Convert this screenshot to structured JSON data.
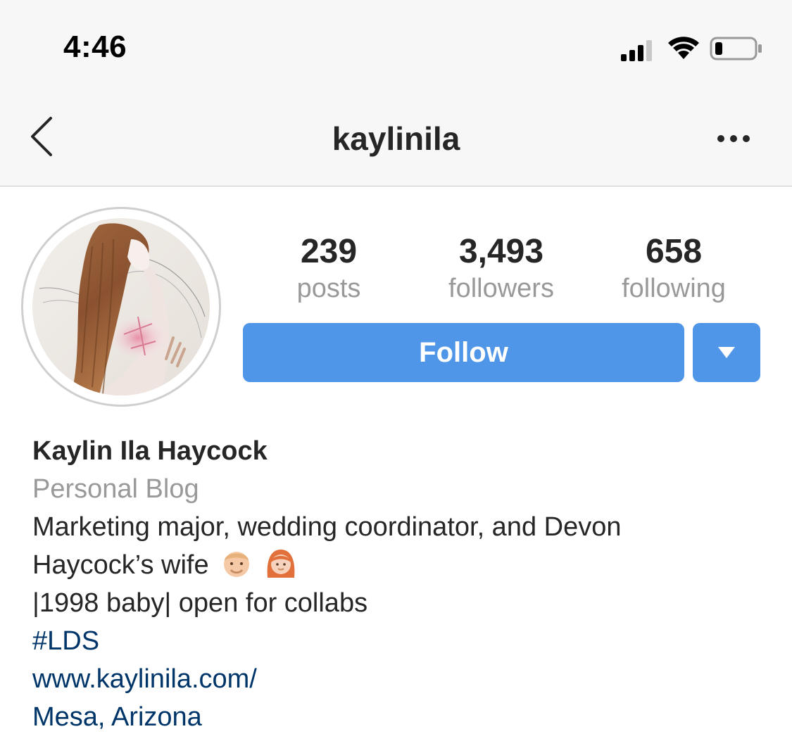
{
  "status_bar": {
    "time": "4:46",
    "signal_icon": "cellular-signal-icon",
    "wifi_icon": "wifi-icon",
    "battery_icon": "battery-low-icon"
  },
  "nav": {
    "back_icon": "chevron-left-icon",
    "title": "kaylinila",
    "more_icon": "more-horizontal-icon"
  },
  "profile": {
    "stats": {
      "posts": {
        "value": "239",
        "label": "posts"
      },
      "followers": {
        "value": "3,493",
        "label": "followers"
      },
      "following": {
        "value": "658",
        "label": "following"
      }
    },
    "follow_label": "Follow",
    "dropdown_icon": "caret-down-icon"
  },
  "bio": {
    "name": "Kaylin Ila Haycock",
    "category": "Personal Blog",
    "line1": "Marketing major, wedding coordinator, and Devon",
    "line2": "Haycock’s wife",
    "line3": "|1998 baby| open for collabs",
    "hashtag": "#LDS",
    "website": "www.kaylinila.com/",
    "location": "Mesa, Arizona"
  },
  "colors": {
    "accent": "#4f96e8",
    "link": "#003569",
    "muted": "#999999",
    "text": "#262626",
    "topbar_bg": "#f7f7f7"
  }
}
